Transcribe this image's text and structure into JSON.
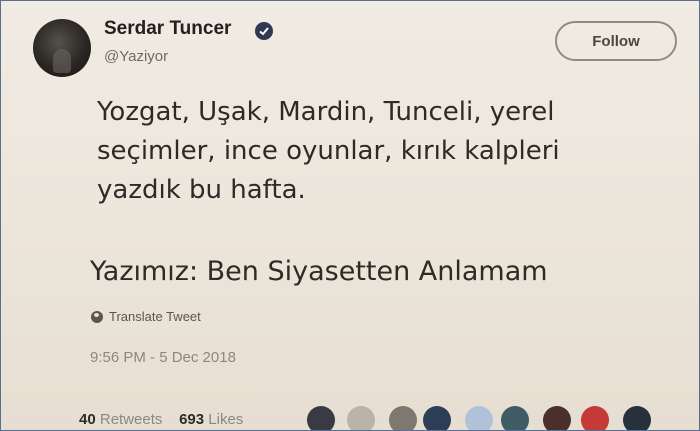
{
  "tweet": {
    "author_name": "Serdar Tuncer",
    "handle": "@Yaziyor",
    "follow_label": "Follow",
    "text_lines": [
      "Yozgat, Uşak, Mardin, Tunceli, yerel",
      "seçimler, ince oyunlar, kırık kalpleri",
      "yazdık bu hafta."
    ],
    "title_line": "Yazımız: Ben Siyasetten Anlamam",
    "translate_label": "Translate Tweet",
    "timestamp": "9:56 PM - 5 Dec 2018",
    "retweets_count": "40",
    "retweets_label": "Retweets",
    "likes_count": "693",
    "likes_label": "Likes"
  },
  "colors": {
    "background": "#ece5da",
    "text": "#2e2b27",
    "muted": "#8c8780",
    "verified_badge": "#2f3a52"
  },
  "likers": [
    {
      "name": "liker-avatar-1",
      "color": "#3a3a44"
    },
    {
      "name": "liker-avatar-2",
      "color": "#b9b3aa"
    },
    {
      "name": "liker-avatar-3",
      "color": "#7d7870"
    },
    {
      "name": "liker-avatar-4",
      "color": "#2c3e56"
    },
    {
      "name": "liker-avatar-5",
      "color": "#b0c2d8"
    },
    {
      "name": "liker-avatar-6",
      "color": "#3e5b66"
    },
    {
      "name": "liker-avatar-7",
      "color": "#4a2f2a"
    },
    {
      "name": "liker-avatar-8",
      "color": "#c43a36"
    },
    {
      "name": "liker-avatar-9",
      "color": "#27313b"
    }
  ]
}
